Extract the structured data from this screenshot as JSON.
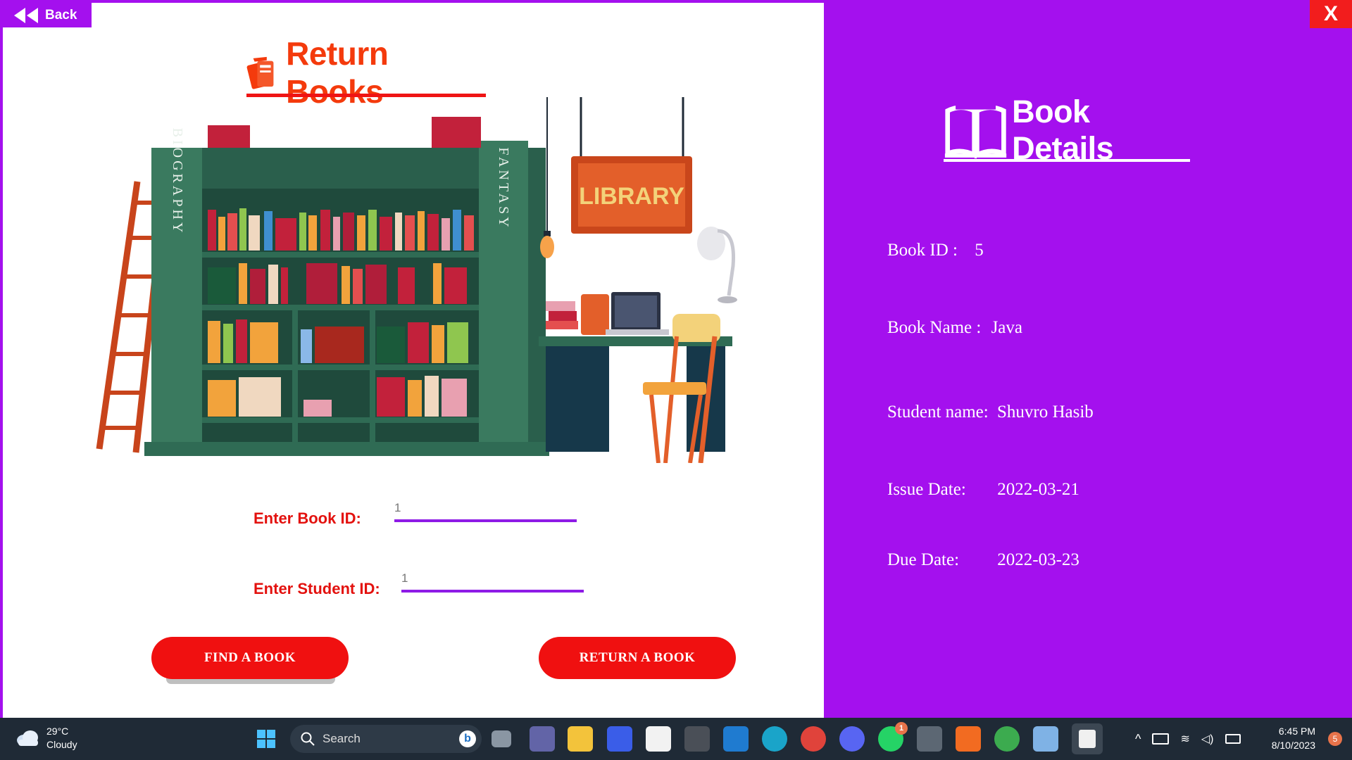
{
  "window": {
    "back_label": "Back",
    "close_label": "X"
  },
  "left": {
    "title": "Return Books",
    "illustration": {
      "biography_label": "BIOGRAPHY",
      "fantasy_label": "FANTASY",
      "sign_label": "LIBRARY"
    },
    "form": {
      "book_id_label": "Enter Book ID:",
      "book_id_value": "1",
      "student_id_label": "Enter Student ID:",
      "student_id_value": "1"
    },
    "buttons": {
      "find_label": "FIND A BOOK",
      "return_label": "RETURN A BOOK"
    }
  },
  "details": {
    "title": "Book Details",
    "rows": [
      {
        "label": "Book ID :",
        "value": "5"
      },
      {
        "label": "Book Name :",
        "value": "Java"
      },
      {
        "label": "Student name:",
        "value": "Shuvro Hasib"
      },
      {
        "label": "Issue Date:",
        "value": "2022-03-21"
      },
      {
        "label": "Due Date:",
        "value": "2022-03-23"
      }
    ]
  },
  "taskbar": {
    "weather_temp": "29°C",
    "weather_desc": "Cloudy",
    "search_label": "Search",
    "time": "6:45 PM",
    "date": "8/10/2023",
    "notification_count": "5",
    "whatsapp_badge": "1"
  },
  "colors": {
    "accent_purple": "#a410ee",
    "title_red": "#f43a0c",
    "button_red": "#f01010",
    "taskbar_bg": "#1f2a36"
  }
}
